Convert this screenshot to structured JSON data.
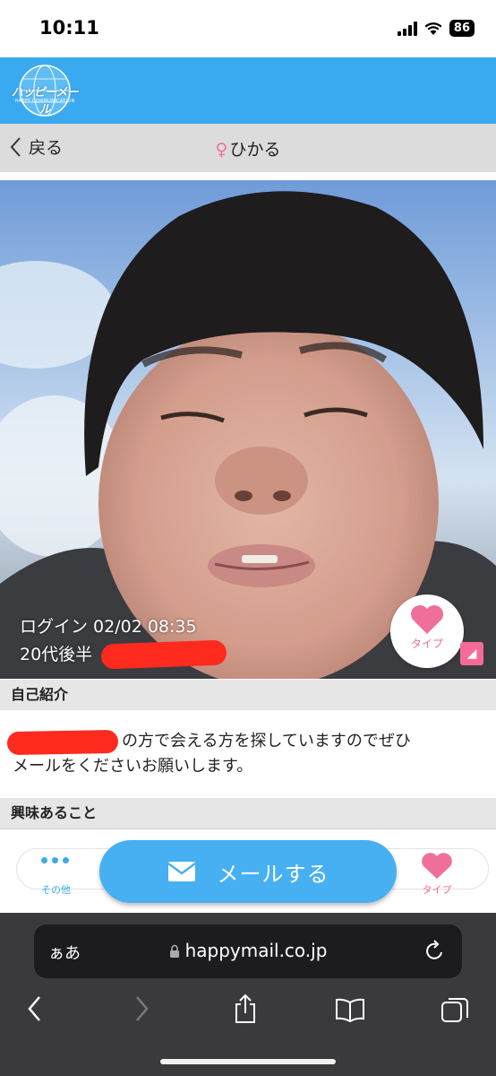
{
  "status_bar": {
    "time": "10:11",
    "battery": "86"
  },
  "app_header": {
    "logo_text": "ハッピーメール",
    "logo_subtext": "HAPPY COMMUNICATION"
  },
  "nav": {
    "back_label": "戻る",
    "gender_symbol": "♀",
    "title": "ひかる"
  },
  "profile": {
    "login": "ログイン 02/02 08:35",
    "age": "20代後半",
    "type_label": "タイプ"
  },
  "intro": {
    "header": "自己紹介",
    "line1": "の方で会える方を探していますのでぜひ",
    "line2": "メールをくださいお願いします。"
  },
  "interests": {
    "header": "興味あること",
    "more_label": "その他",
    "fav_label": "タイプ"
  },
  "action": {
    "mail_label": "メールする"
  },
  "browser": {
    "aa_label": "ぁあ",
    "url": "happymail.co.jp"
  },
  "colors": {
    "brand": "#3aaaf0",
    "pink": "#f06e9a",
    "redaction": "#ff2a1e"
  }
}
